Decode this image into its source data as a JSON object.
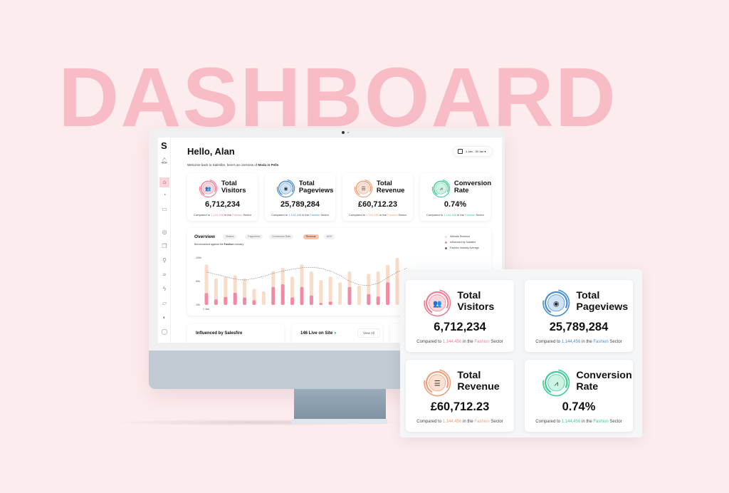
{
  "hero_title": "DASHBOARD",
  "app": {
    "logo": "S",
    "sidebar": [
      "bell-icon",
      "home-icon",
      "pie-chart-icon",
      "archive-icon",
      "fingerprint-icon",
      "copy-icon",
      "search-icon",
      "scan-icon",
      "zap-icon",
      "inbox-icon",
      "toggle-icon",
      "chat-icon"
    ],
    "greeting": "Hello, Alan",
    "welcome_prefix": "Welcome back to Salesfire, here's an overview of ",
    "welcome_store": "Moda in Pelle",
    "welcome_suffix": ".",
    "date_range": "1 Jan - 30 Jan ▾"
  },
  "colors": {
    "pink": "#ef7f95",
    "blue": "#4b8fd1",
    "orange": "#eca07c",
    "green": "#3dcd95"
  },
  "stats": [
    {
      "title1": "Total",
      "title2": "Visitors",
      "value": "6,712,234",
      "cmp_prefix": "Compared to ",
      "cmp_value": "1,144,456",
      "cmp_mid": " in the ",
      "cmp_sector": "Fashion",
      "cmp_suffix": " Sector",
      "color": "pink",
      "light": "#fbd6dd",
      "icon": "users-icon",
      "glyph": "👥"
    },
    {
      "title1": "Total",
      "title2": "Pageviews",
      "value": "25,789,284",
      "cmp_prefix": "Compared to ",
      "cmp_value": "1,144,456",
      "cmp_mid": " in the ",
      "cmp_sector": "Fashion",
      "cmp_suffix": " Sector",
      "color": "blue",
      "light": "#cfe4f7",
      "icon": "eye-icon",
      "glyph": "◉"
    },
    {
      "title1": "Total",
      "title2": "Revenue",
      "value": "£60,712.23",
      "cmp_prefix": "Compared to ",
      "cmp_value": "1,144,456",
      "cmp_mid": " in the ",
      "cmp_sector": "Fashion",
      "cmp_suffix": " Sector",
      "color": "orange",
      "light": "#fbe0d3",
      "icon": "coins-icon",
      "glyph": "☰"
    },
    {
      "title1": "Conversion",
      "title2": "Rate",
      "value": "0.74%",
      "cmp_prefix": "Compared to ",
      "cmp_value": "1,144,456",
      "cmp_mid": " in the ",
      "cmp_sector": "Fashion",
      "cmp_suffix": " Sector",
      "color": "green",
      "light": "#cdf3e3",
      "icon": "chart-line-icon",
      "glyph": "⩘"
    }
  ],
  "overview": {
    "title": "Overview",
    "tabs": [
      "Visitors",
      "Pageviews",
      "Conversion Rate",
      "Revenue",
      "AOV"
    ],
    "active_tab": "Revenue",
    "bench_prefix": "Benchmarked against the ",
    "bench_industry": "Fashion",
    "bench_suffix": " Industry",
    "legend": [
      {
        "label": "Website Revenue",
        "color": "#f9dcc8"
      },
      {
        "label": "Influenced by Salesfire",
        "color": "#f28aa3"
      },
      {
        "label": "Fashion Industry Average",
        "color": "#666666"
      }
    ]
  },
  "chart_data": {
    "type": "bar",
    "yticks": [
      "100k",
      "50k",
      "10k"
    ],
    "ylim": [
      0,
      100
    ],
    "first_x_label": "1 Jan",
    "series": [
      {
        "name": "Website Revenue",
        "values": [
          86,
          56,
          60,
          63,
          56,
          34,
          29,
          72,
          79,
          60,
          86,
          71,
          53,
          60,
          48,
          71,
          41,
          66,
          71,
          85,
          100,
          60
        ]
      },
      {
        "name": "Influenced by Salesfire",
        "values": [
          25,
          12,
          17,
          26,
          16,
          10,
          0,
          38,
          44,
          16,
          38,
          20,
          4,
          7,
          0,
          38,
          0,
          23,
          18,
          48,
          0,
          0
        ]
      },
      {
        "name": "Fashion Industry Average",
        "values": [
          70,
          65,
          60,
          55,
          53,
          56,
          61,
          67,
          72,
          76,
          79,
          80,
          78,
          72,
          63,
          50,
          43,
          41,
          46,
          58,
          70,
          78
        ]
      }
    ]
  },
  "panels": {
    "influenced": "Influenced by Salesfire",
    "live": "146 Live on Site",
    "view_all": "View All"
  }
}
